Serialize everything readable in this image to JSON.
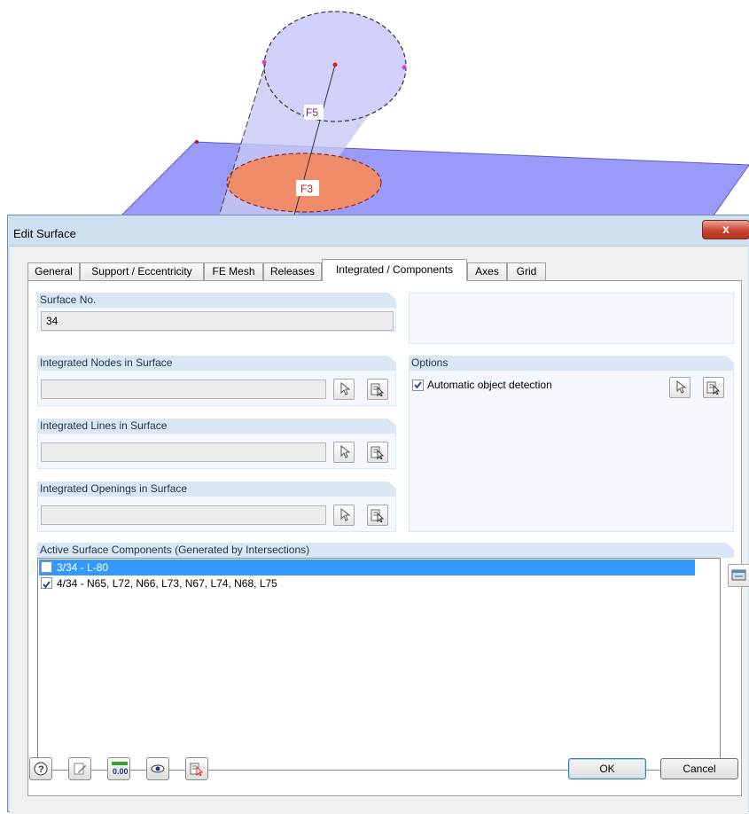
{
  "scene": {
    "label_top": "F5",
    "label_bottom": "F3"
  },
  "dialog": {
    "title": "Edit Surface",
    "close_label": "x",
    "tabs": [
      {
        "label": "General"
      },
      {
        "label": "Support / Eccentricity"
      },
      {
        "label": "FE Mesh"
      },
      {
        "label": "Releases"
      },
      {
        "label": "Integrated / Components"
      },
      {
        "label": "Axes"
      },
      {
        "label": "Grid"
      }
    ],
    "active_tab": "Integrated / Components",
    "surface_no": {
      "label": "Surface No.",
      "value": "34"
    },
    "integrated_nodes": {
      "label": "Integrated Nodes in Surface",
      "value": ""
    },
    "integrated_lines": {
      "label": "Integrated Lines in Surface",
      "value": ""
    },
    "integrated_openings": {
      "label": "Integrated Openings in Surface",
      "value": ""
    },
    "options": {
      "label": "Options",
      "auto_detect_label": "Automatic object detection",
      "auto_detect_checked": true
    },
    "components": {
      "label": "Active Surface Components (Generated by Intersections)",
      "items": [
        {
          "text": "3/34 - L-80",
          "checked": false,
          "selected": true
        },
        {
          "text": "4/34 - N65, L72, N66, L73, N67, L74, N68, L75",
          "checked": true,
          "selected": false
        }
      ]
    },
    "ok_label": "OK",
    "cancel_label": "Cancel",
    "zero_icon_text": "0.00"
  }
}
